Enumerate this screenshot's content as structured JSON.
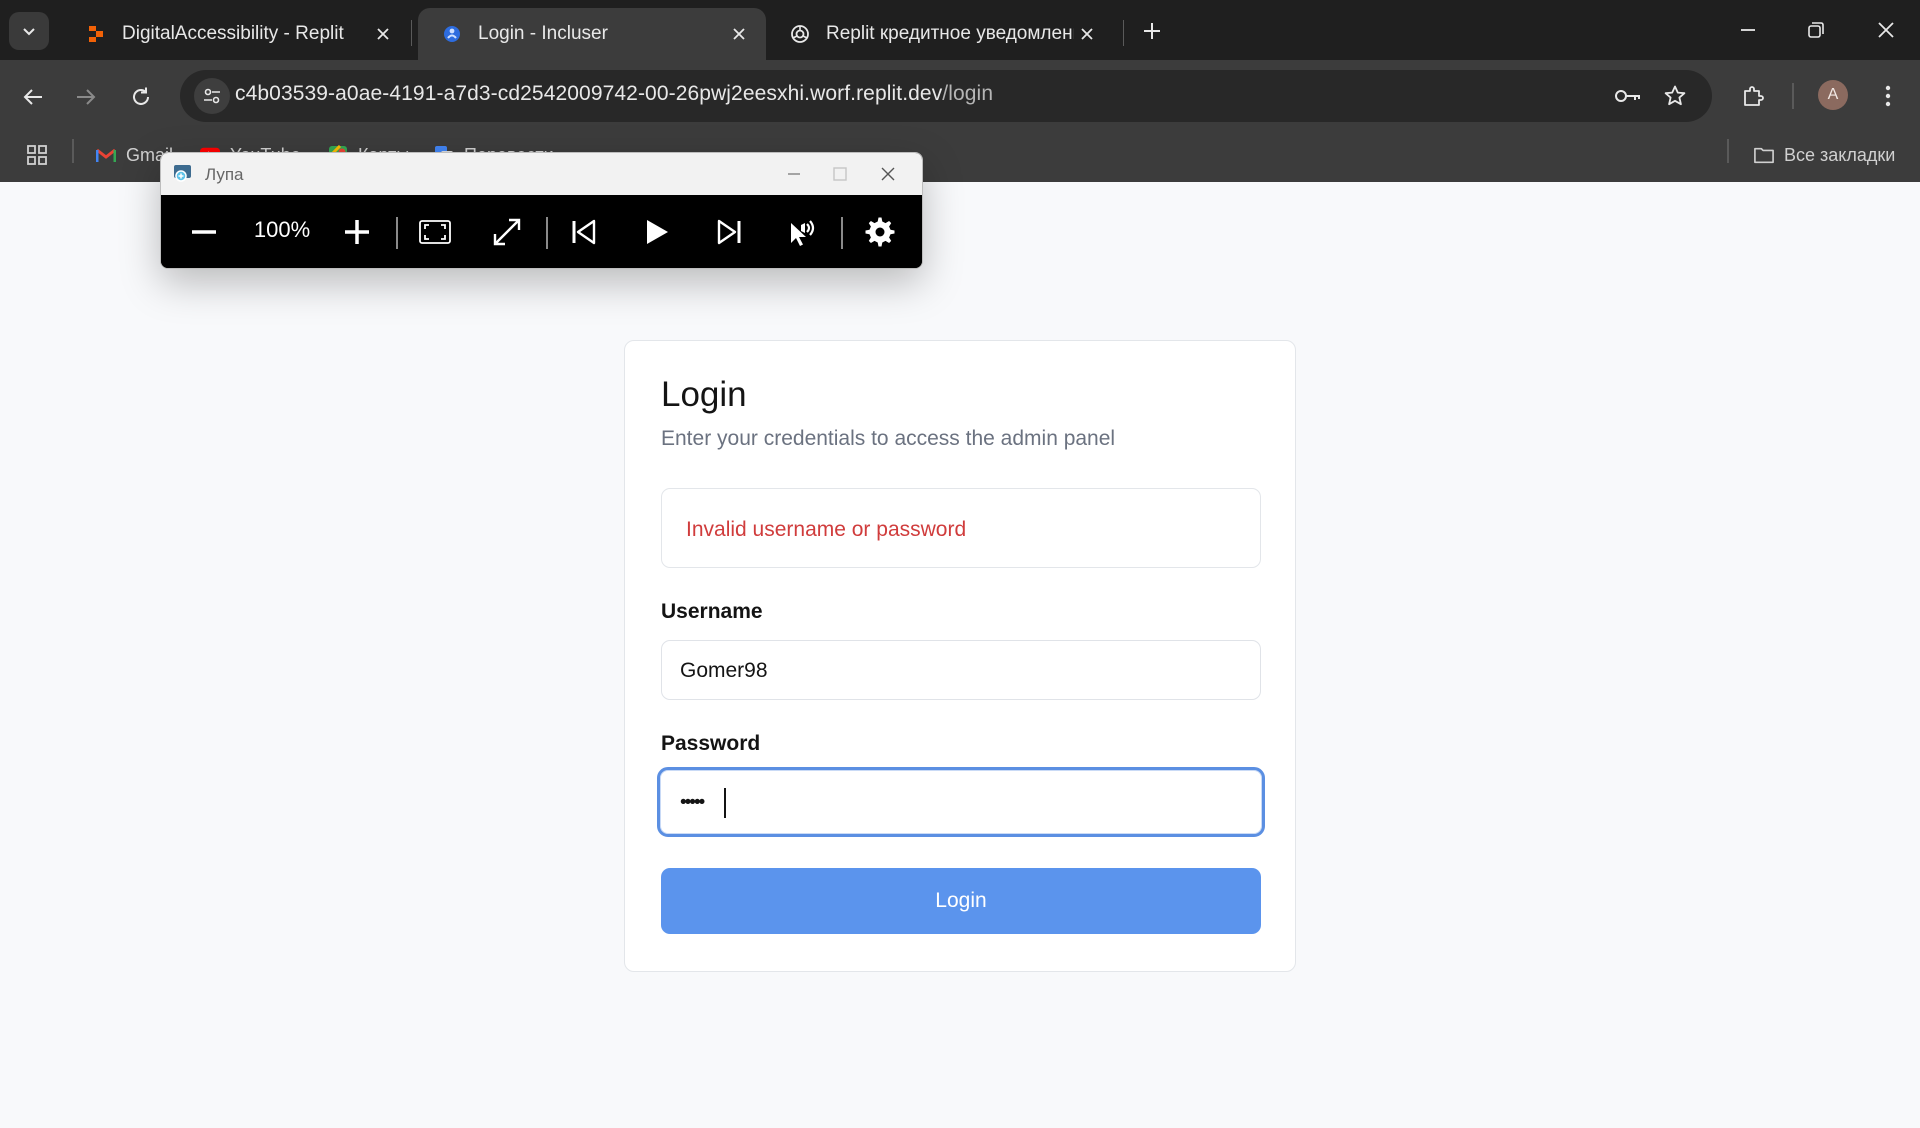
{
  "browser": {
    "tabs": [
      {
        "title": "DigitalAccessibility - Replit",
        "active": false
      },
      {
        "title": "Login - Incluser",
        "active": true
      },
      {
        "title": "Replit кредитное уведомление",
        "active": false
      }
    ],
    "address": {
      "host": "c4b03539-a0ae-4191-a7d3-cd2542009742-00-26pwj2eesxhi.worf.replit.dev",
      "path": "/login"
    },
    "profile_initial": "A",
    "bookmarks": [
      "Gmail",
      "YouTube",
      "Карты",
      "Перевести"
    ],
    "all_bookmarks_label": "Все закладки"
  },
  "magnifier": {
    "title": "Лупа",
    "zoom": "100%"
  },
  "login": {
    "title": "Login",
    "description": "Enter your credentials to access the admin panel",
    "error": "Invalid username or password",
    "username_label": "Username",
    "username_value": "Gomer98",
    "password_label": "Password",
    "password_masked": "•••••",
    "button_label": "Login"
  },
  "colors": {
    "accent": "#5b94ed",
    "error": "#d03c3c",
    "focus_ring": "#5b8fe2"
  }
}
